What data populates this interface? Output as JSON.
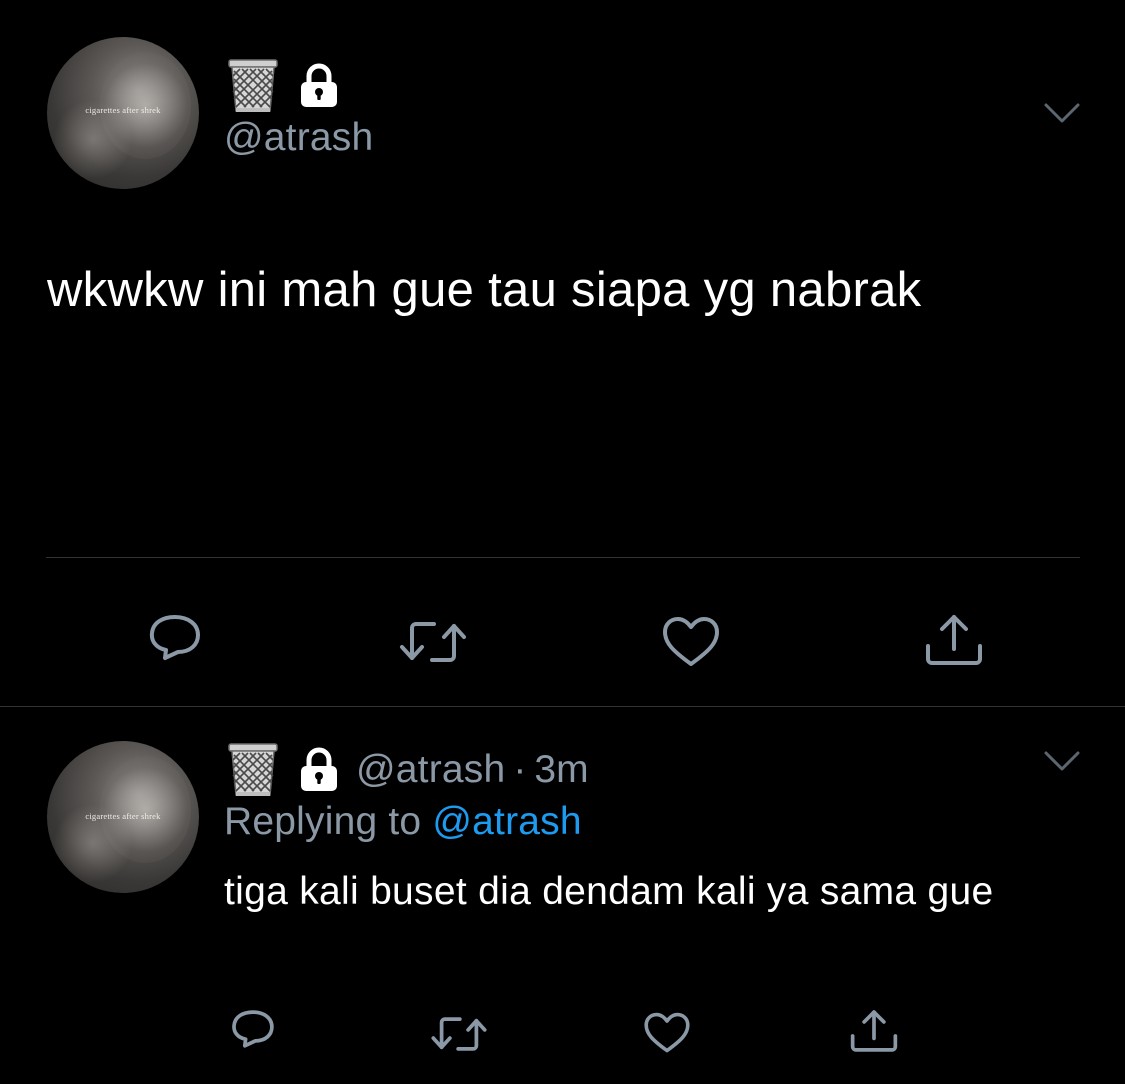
{
  "main_tweet": {
    "avatar_caption": "cigarettes after shrek",
    "display_name_emoji": "wastebasket-emoji",
    "protected": true,
    "handle": "@atrash",
    "text": "wkwkw ini mah gue tau siapa yg nabrak"
  },
  "reply_tweet": {
    "avatar_caption": "cigarettes after shrek",
    "display_name_emoji": "wastebasket-emoji",
    "protected": true,
    "handle": "@atrash",
    "separator": "·",
    "time": "3m",
    "replying_prefix": "Replying to",
    "replying_to": "@atrash",
    "text": "tiga kali buset dia dendam kali ya sama gue"
  },
  "icons": {
    "reply": "reply-icon",
    "retweet": "retweet-icon",
    "like": "like-icon",
    "share": "share-icon",
    "more": "chevron-down-icon"
  },
  "colors": {
    "background": "#000000",
    "text": "#ffffff",
    "secondary": "#8b98a5",
    "link": "#1d9bf0",
    "divider": "#2f3336"
  }
}
